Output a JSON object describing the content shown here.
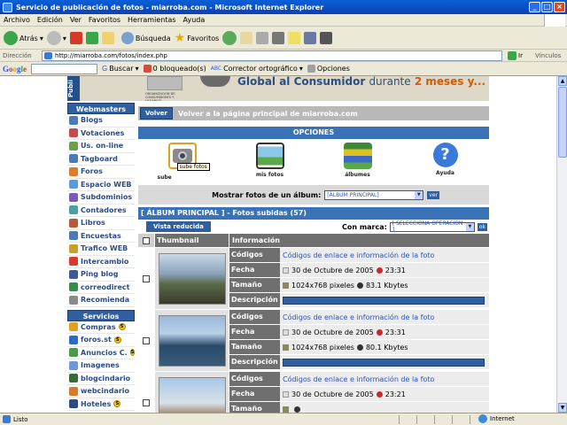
{
  "window": {
    "title": "Servicio de publicación de fotos - miarroba.com - Microsoft Internet Explorer"
  },
  "menu": [
    "Archivo",
    "Edición",
    "Ver",
    "Favoritos",
    "Herramientas",
    "Ayuda"
  ],
  "toolbar": {
    "back": "Atrás",
    "search": "Búsqueda",
    "favorites": "Favoritos"
  },
  "address": {
    "label": "Dirección",
    "url": "http://miarroba.com/fotos/index.php",
    "go": "Ir",
    "links": "Vínculos"
  },
  "googlebar": {
    "logo": "Google",
    "search": "Buscar",
    "blocked": "0 bloqueado(s)",
    "spell": "Corrector ortográfico",
    "options": "Opciones"
  },
  "banner": {
    "pub": "Publi",
    "org": "ORGANIZACIÓN DE CONSUMIDORES Y USUARIOS",
    "text_a": "Global al Consumidor",
    "text_b": "durante",
    "text_c": "2 meses y..."
  },
  "sidebar": {
    "webmasters_title": "Webmasters",
    "webmasters": [
      {
        "label": "Blogs",
        "color": "#4a7ab8"
      },
      {
        "label": "Votaciones",
        "color": "#c84a4a"
      },
      {
        "label": "Us. on-line",
        "color": "#6aa04a"
      },
      {
        "label": "Tagboard",
        "color": "#4a7ab8"
      },
      {
        "label": "Foros",
        "color": "#e07a2a"
      },
      {
        "label": "Espacio WEB",
        "color": "#5a9ad8"
      },
      {
        "label": "Subdominios",
        "color": "#7a5ab8"
      },
      {
        "label": "Contadores",
        "color": "#4aa0a0"
      },
      {
        "label": "Libros",
        "color": "#b85a3a"
      },
      {
        "label": "Encuestas",
        "color": "#4a7ab8"
      },
      {
        "label": "Trafico WEB",
        "color": "#c8a02a"
      },
      {
        "label": "Intercambio",
        "color": "#d83a2a"
      },
      {
        "label": "Ping blog",
        "color": "#3a5a9a"
      },
      {
        "label": "correodirect",
        "color": "#3a8a4a"
      },
      {
        "label": "Recomienda",
        "color": "#8a8a8a"
      }
    ],
    "servicios_title": "Servicios",
    "servicios": [
      {
        "label": "Compras",
        "color": "#e0a020",
        "badge": "S"
      },
      {
        "label": "foros.st",
        "color": "#2a6ac8",
        "badge": "S"
      },
      {
        "label": "Anuncios C.",
        "color": "#4a9a4a",
        "badge": "S"
      },
      {
        "label": "Imagenes",
        "color": "#6a9ad8"
      },
      {
        "label": "blogcindario",
        "color": "#3a6a3a"
      },
      {
        "label": "webcindario",
        "color": "#d87a2a"
      },
      {
        "label": "Hoteles",
        "color": "#2a4a8a",
        "badge": "S"
      }
    ]
  },
  "main": {
    "volver_btn": "Volver",
    "volver_text": "Volver a la página principal de miarroba.com",
    "opciones_title": "OPCIONES",
    "options": [
      {
        "label": "sube fotos",
        "tooltip": "sube fotos"
      },
      {
        "label": "mis fotos"
      },
      {
        "label": "álbumes"
      },
      {
        "label": "Ayuda"
      }
    ],
    "album_label": "Mostrar fotos de un álbum:",
    "album_value": "[ÁLBUM PRINCIPAL]",
    "ver": "ver",
    "section_title": "[ ÁLBUM PRINCIPAL ] - Fotos subidas (57)",
    "vista": "Vista reducida",
    "con_marca": "Con marca:",
    "marca_value": "[ SELECCIONA OPERACION ]",
    "ok": "ok",
    "col_thumb": "Thumbnail",
    "col_info": "Información",
    "keys": {
      "codigos": "Códigos",
      "fecha": "Fecha",
      "tamano": "Tamaño",
      "descripcion": "Descripción"
    },
    "photos": [
      {
        "codes": "Códigos de enlace e información de la foto",
        "date": "30 de Octubre de 2005",
        "time": "23:31",
        "dims": "1024x768 pixeles",
        "size": "83.1 Kbytes"
      },
      {
        "codes": "Códigos de enlace e información de la foto",
        "date": "30 de Octubre de 2005",
        "time": "23:31",
        "dims": "1024x768 pixeles",
        "size": "80.1 Kbytes"
      },
      {
        "codes": "Códigos de enlace e información de la foto",
        "date": "30 de Octubre de 2005",
        "time": "23:21",
        "dims": "",
        "size": ""
      }
    ]
  },
  "status": {
    "text": "Listo",
    "zone": "Internet"
  }
}
